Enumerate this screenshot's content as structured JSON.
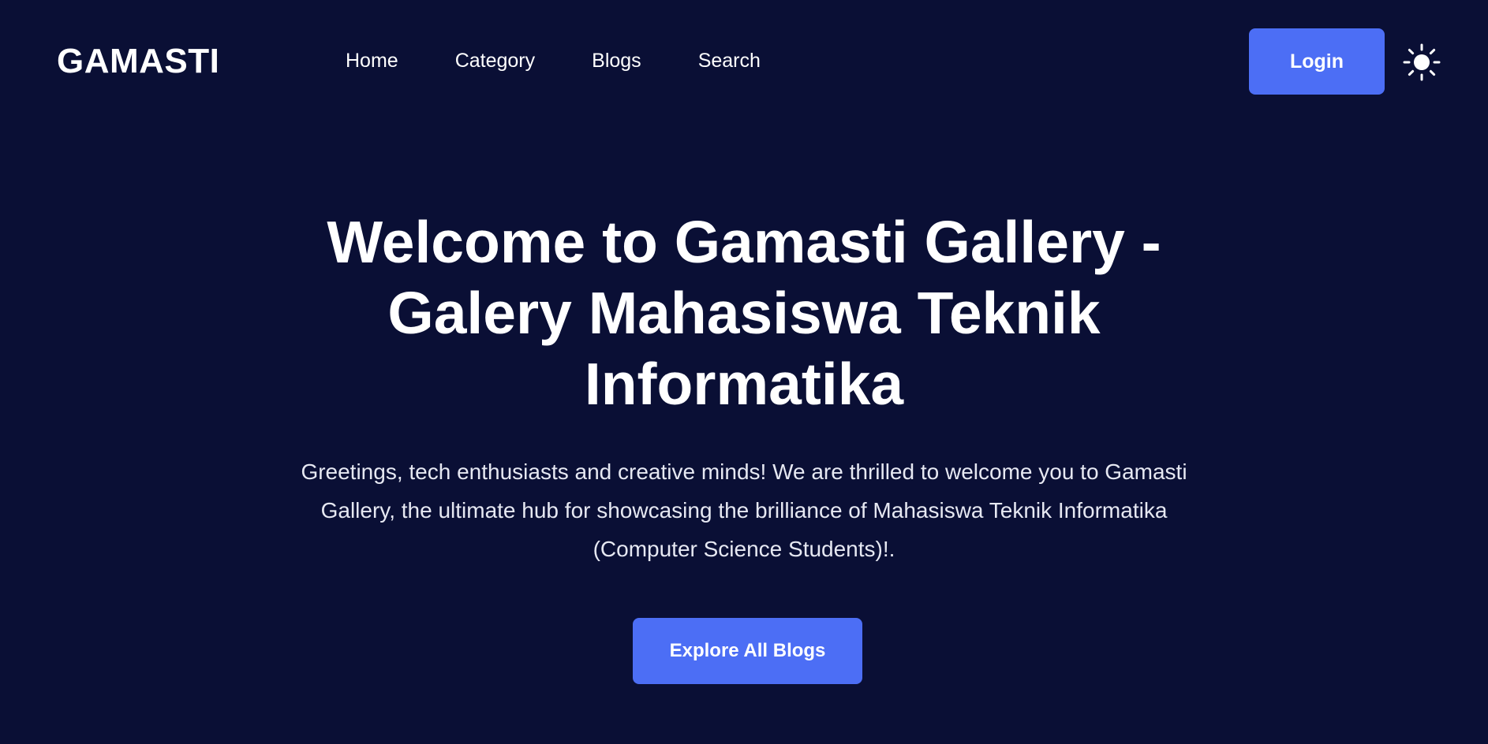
{
  "brand": {
    "logo_text": "GAMASTI"
  },
  "nav": {
    "items": [
      {
        "label": "Home"
      },
      {
        "label": "Category"
      },
      {
        "label": "Blogs"
      },
      {
        "label": "Search"
      }
    ],
    "login_label": "Login",
    "theme_icon": "sun-icon"
  },
  "hero": {
    "title": "Welcome to Gamasti Gallery - Galery Mahasiswa Teknik Informatika",
    "description": "Greetings, tech enthusiasts and creative minds! We are thrilled to welcome you to Gamasti Gallery, the ultimate hub for showcasing the brilliance of Mahasiswa Teknik Informatika (Computer Science Students)!.",
    "cta_label": "Explore All Blogs"
  },
  "colors": {
    "background": "#0a0f35",
    "accent": "#4c6ef5",
    "text": "#ffffff"
  }
}
